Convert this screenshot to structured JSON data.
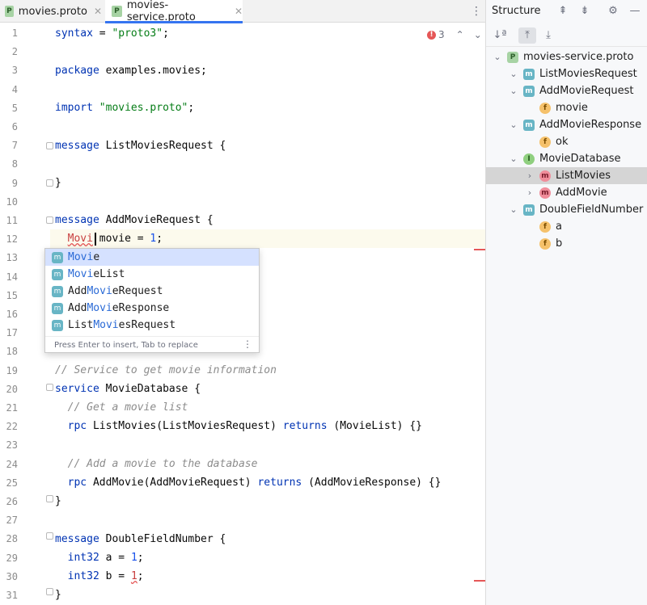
{
  "tabs": [
    {
      "label": "movies.proto",
      "icon": "P",
      "close": "✕"
    },
    {
      "label": "movies-service.proto",
      "icon": "P",
      "close": "✕",
      "active": true
    }
  ],
  "editor": {
    "line_numbers": [
      "1",
      "2",
      "3",
      "4",
      "5",
      "6",
      "7",
      "8",
      "9",
      "10",
      "11",
      "12",
      "13",
      "14",
      "15",
      "16",
      "17",
      "18",
      "19",
      "20",
      "21",
      "22",
      "23",
      "24",
      "25",
      "26",
      "27",
      "28",
      "29",
      "30",
      "31"
    ],
    "inspection": {
      "error_count": "3",
      "error_icon": "!",
      "prev": "⌃",
      "next": "⌄"
    },
    "code": {
      "l1_kw": "syntax",
      "l1_eq": " = ",
      "l1_str": "\"proto3\"",
      "l1_end": ";",
      "l3_kw": "package",
      "l3_rest": " examples.movies;",
      "l5_kw": "import",
      "l5_sp": " ",
      "l5_str": "\"movies.proto\"",
      "l5_end": ";",
      "l7_kw": "message",
      "l7_rest": " ListMoviesRequest {",
      "l9": "}",
      "l11_kw": "message",
      "l11_rest": " AddMovieRequest {",
      "l12_ind": "  ",
      "l12_err": "Movi",
      "l12_mid": " movie = ",
      "l12_num": "1",
      "l12_end": ";",
      "l19_cmt": "// Service to get movie information",
      "l20_kw": "service",
      "l20_rest": " MovieDatabase {",
      "l21_cmt": "  // Get a movie list",
      "l22_ind": "  ",
      "l22_kw": "rpc",
      "l22_mid": " ListMovies(ListMoviesRequest) ",
      "l22_kw2": "returns",
      "l22_end": " (MovieList) {}",
      "l24_cmt": "  // Add a movie to the database",
      "l25_ind": "  ",
      "l25_kw": "rpc",
      "l25_mid": " AddMovie(AddMovieRequest) ",
      "l25_kw2": "returns",
      "l25_end": " (AddMovieResponse) {}",
      "l26": "}",
      "l28_kw": "message",
      "l28_rest": " DoubleFieldNumber {",
      "l29_ind": "  ",
      "l29_kw": "int32",
      "l29_mid": " a = ",
      "l29_num": "1",
      "l29_end": ";",
      "l30_ind": "  ",
      "l30_kw": "int32",
      "l30_mid": " b = ",
      "l30_num": "1",
      "l30_end": ";",
      "l31": "}"
    }
  },
  "completion": {
    "items": [
      {
        "badge": "m",
        "pre": "",
        "match": "Movi",
        "post": "e"
      },
      {
        "badge": "m",
        "pre": "",
        "match": "Movi",
        "post": "eList"
      },
      {
        "badge": "m",
        "pre": "Add",
        "match": "Movi",
        "post": "eRequest"
      },
      {
        "badge": "m",
        "pre": "Add",
        "match": "Movi",
        "post": "eResponse"
      },
      {
        "badge": "m",
        "pre": "List",
        "match": "Movi",
        "post": "esRequest"
      }
    ],
    "footer": "Press Enter to insert, Tab to replace",
    "more": "⋮"
  },
  "structure": {
    "title": "Structure",
    "tree": [
      {
        "label": "movies-service.proto",
        "icon": "P",
        "kind": "file",
        "chev": "⌄"
      },
      {
        "label": "ListMoviesRequest",
        "icon": "m",
        "kind": "msg",
        "chev": "⌄"
      },
      {
        "label": "AddMovieRequest",
        "icon": "m",
        "kind": "msg",
        "chev": "⌄"
      },
      {
        "label": "movie",
        "icon": "f",
        "kind": "field",
        "chev": ""
      },
      {
        "label": "AddMovieResponse",
        "icon": "m",
        "kind": "msg",
        "chev": "⌄"
      },
      {
        "label": "ok",
        "icon": "f",
        "kind": "field",
        "chev": ""
      },
      {
        "label": "MovieDatabase",
        "icon": "I",
        "kind": "svc",
        "chev": "⌄"
      },
      {
        "label": "ListMovies",
        "icon": "m",
        "kind": "rpc",
        "chev": "›"
      },
      {
        "label": "AddMovie",
        "icon": "m",
        "kind": "rpc",
        "chev": "›"
      },
      {
        "label": "DoubleFieldNumber",
        "icon": "m",
        "kind": "msg",
        "chev": "⌄"
      },
      {
        "label": "a",
        "icon": "f",
        "kind": "field",
        "chev": ""
      },
      {
        "label": "b",
        "icon": "f",
        "kind": "field",
        "chev": ""
      }
    ],
    "header_icons": [
      "expand-all-icon",
      "collapse-all-icon",
      "gear-icon",
      "minimize-icon"
    ],
    "toolbar_icons": [
      "sort-alpha-icon",
      "scroll-from-source-icon",
      "scroll-to-source-icon"
    ]
  },
  "colors": {
    "accent": "#3574f0",
    "selection": "#d5e1ff",
    "error": "#e55757",
    "keyword": "#0033b3",
    "string": "#067d17"
  }
}
